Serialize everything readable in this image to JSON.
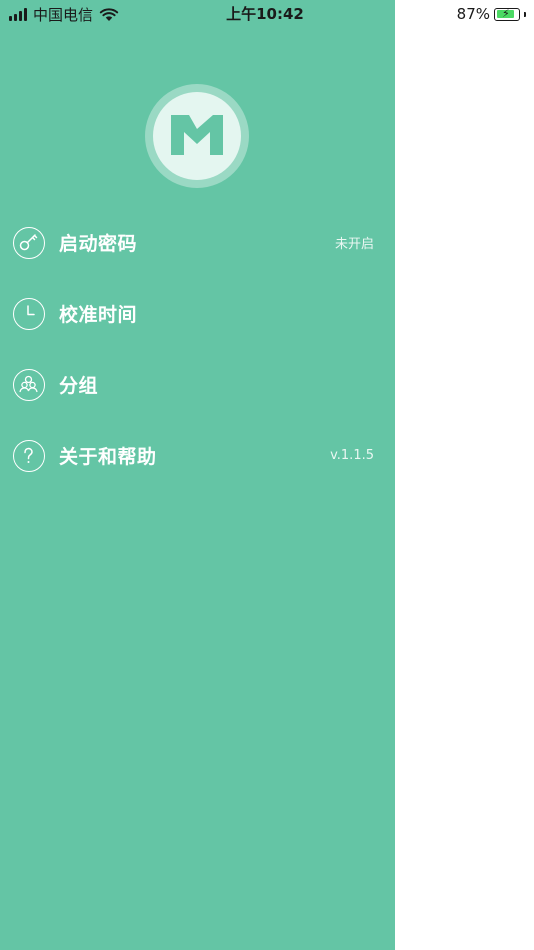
{
  "status_bar": {
    "carrier": "中国电信",
    "time": "上午10:42",
    "battery": "87%",
    "battery_fraction": 0.87
  },
  "colors": {
    "drawer_background": "#64c5a5",
    "logo_mark": "#64c5a5"
  },
  "logo": {
    "icon": "m-logo-icon"
  },
  "menu": {
    "items": [
      {
        "label": "启动密码",
        "value": "未开启",
        "icon": "key-icon"
      },
      {
        "label": "校准时间",
        "value": "",
        "icon": "clock-icon"
      },
      {
        "label": "分组",
        "value": "",
        "icon": "group-icon"
      },
      {
        "label": "关于和帮助",
        "value": "v.1.1.5",
        "icon": "question-icon"
      }
    ]
  }
}
